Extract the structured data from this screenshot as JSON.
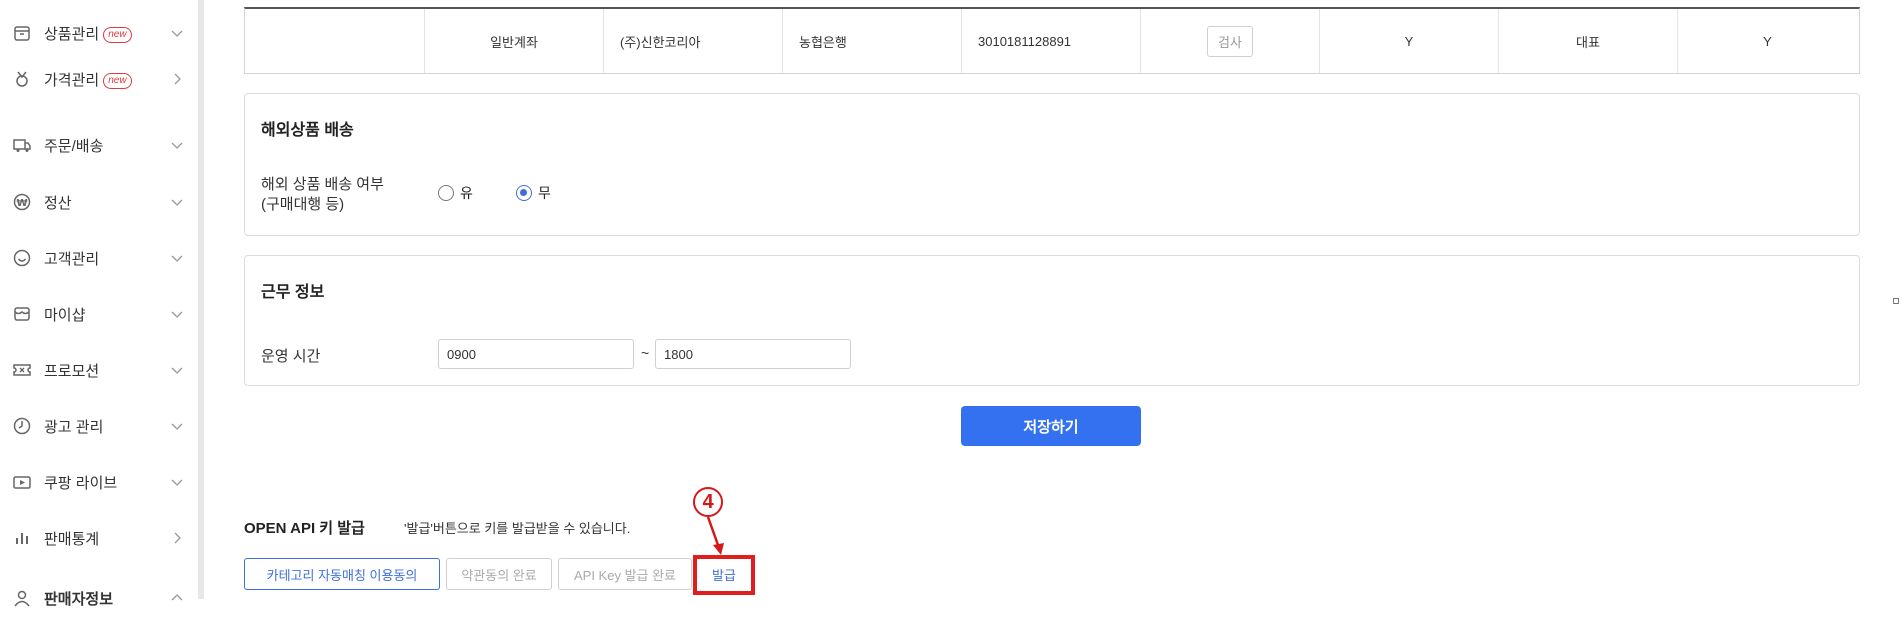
{
  "sidebar": {
    "items": [
      {
        "label": "상품관리",
        "badge": "new",
        "icon": "box-icon",
        "chevron": "down"
      },
      {
        "label": "가격관리",
        "badge": "new",
        "icon": "medal-icon",
        "chevron": "right"
      },
      {
        "label": "주문/배송",
        "badge": "",
        "icon": "truck-icon",
        "chevron": "down"
      },
      {
        "label": "정산",
        "badge": "",
        "icon": "won-coin-icon",
        "chevron": "down"
      },
      {
        "label": "고객관리",
        "badge": "",
        "icon": "smile-icon",
        "chevron": "down"
      },
      {
        "label": "마이샵",
        "badge": "",
        "icon": "shop-icon",
        "chevron": "down"
      },
      {
        "label": "프로모션",
        "badge": "",
        "icon": "ticket-icon",
        "chevron": "down"
      },
      {
        "label": "광고 관리",
        "badge": "",
        "icon": "clock-icon",
        "chevron": "down"
      },
      {
        "label": "쿠팡 라이브",
        "badge": "",
        "icon": "live-icon",
        "chevron": "down"
      },
      {
        "label": "판매통계",
        "badge": "",
        "icon": "bar-chart-icon",
        "chevron": "right"
      },
      {
        "label": "판매자정보",
        "badge": "",
        "icon": "person-icon",
        "chevron": "up"
      }
    ]
  },
  "account_row": {
    "cells": [
      "",
      "일반계좌",
      "(주)신한코리아",
      "농협은행",
      "3010181128891",
      "검사",
      "Y",
      "대표",
      "Y"
    ]
  },
  "overseas": {
    "title": "해외상품 배송",
    "field_label_line1": "해외 상품 배송 여부",
    "field_label_line2": "(구매대행 등)",
    "options": [
      {
        "label": "유",
        "selected": false
      },
      {
        "label": "무",
        "selected": true
      }
    ]
  },
  "work": {
    "title": "근무 정보",
    "field_label": "운영 시간",
    "start": "0900",
    "separator": "~",
    "end": "1800"
  },
  "save_label": "저장하기",
  "api": {
    "title": "OPEN API 키 발급",
    "description": "'발급'버튼으로 키를 발급받을 수 있습니다.",
    "steps": [
      "카테고리 자동매칭 이용동의",
      "약관동의 완료",
      "API Key 발급 완료",
      "발급"
    ],
    "step_number": "4"
  },
  "colors": {
    "primary": "#3471f1",
    "highlight": "#e01e1e",
    "badge": "#e0393e"
  }
}
